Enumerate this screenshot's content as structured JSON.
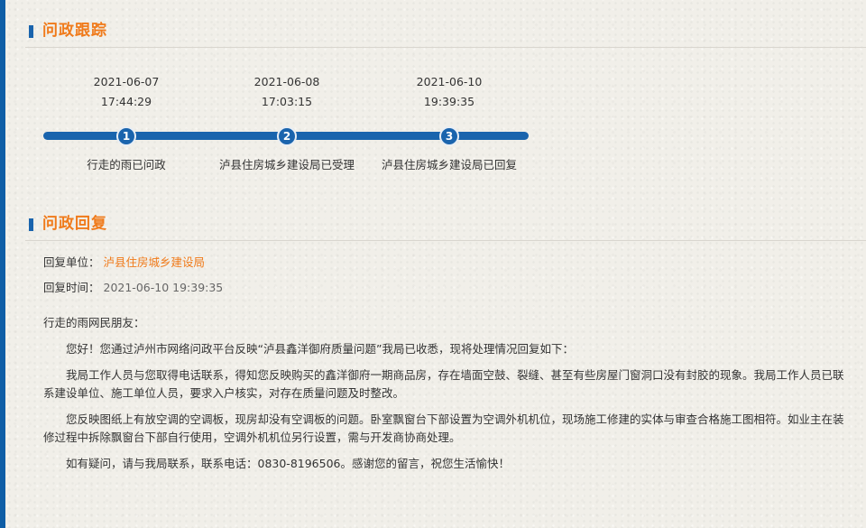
{
  "tracking": {
    "title": "问政跟踪",
    "steps": [
      {
        "number": "1",
        "date": "2021-06-07",
        "time": "17:44:29",
        "label": "行走的雨已问政"
      },
      {
        "number": "2",
        "date": "2021-06-08",
        "time": "17:03:15",
        "label": "泸县住房城乡建设局已受理"
      },
      {
        "number": "3",
        "date": "2021-06-10",
        "time": "19:39:35",
        "label": "泸县住房城乡建设局已回复"
      }
    ]
  },
  "reply": {
    "title": "问政回复",
    "unit_label": "回复单位：",
    "unit_value": "泸县住房城乡建设局",
    "time_label": "回复时间：",
    "time_value": "2021-06-10 19:39:35",
    "greeting": "行走的雨网民朋友：",
    "paragraphs": [
      "您好！您通过泸州市网络问政平台反映“泸县鑫洋御府质量问题”我局已收悉，现将处理情况回复如下：",
      "我局工作人员与您取得电话联系，得知您反映购买的鑫洋御府一期商品房，存在墙面空鼓、裂缝、甚至有些房屋门窗洞口没有封胶的现象。我局工作人员已联系建设单位、施工单位人员，要求入户核实，对存在质量问题及时整改。",
      "您反映图纸上有放空调的空调板，现房却没有空调板的问题。卧室飘窗台下部设置为空调外机机位，现场施工修建的实体与审查合格施工图相符。如业主在装修过程中拆除飘窗台下部自行使用，空调外机机位另行设置，需与开发商协商处理。",
      "如有疑问，请与我局联系，联系电话：0830-8196506。感谢您的留言，祝您生活愉快！"
    ]
  },
  "colors": {
    "accent_orange": "#f07a1a",
    "accent_blue": "#1a64ad"
  }
}
